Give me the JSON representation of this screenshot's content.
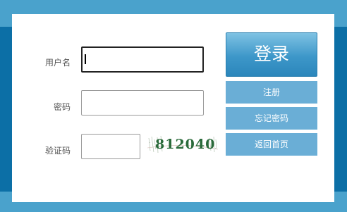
{
  "form": {
    "username_label": "用户名",
    "username_value": "",
    "password_label": "密码",
    "password_value": "",
    "captcha_label": "验证码",
    "captcha_value": "",
    "captcha_text": "812040"
  },
  "buttons": {
    "login": "登录",
    "register": "注册",
    "forgot_password": "忘记密码",
    "back_home": "返回首页"
  },
  "colors": {
    "frame_light": "#4aa2cc",
    "frame_dark": "#0c6fa6",
    "button": "#6aaed6"
  }
}
